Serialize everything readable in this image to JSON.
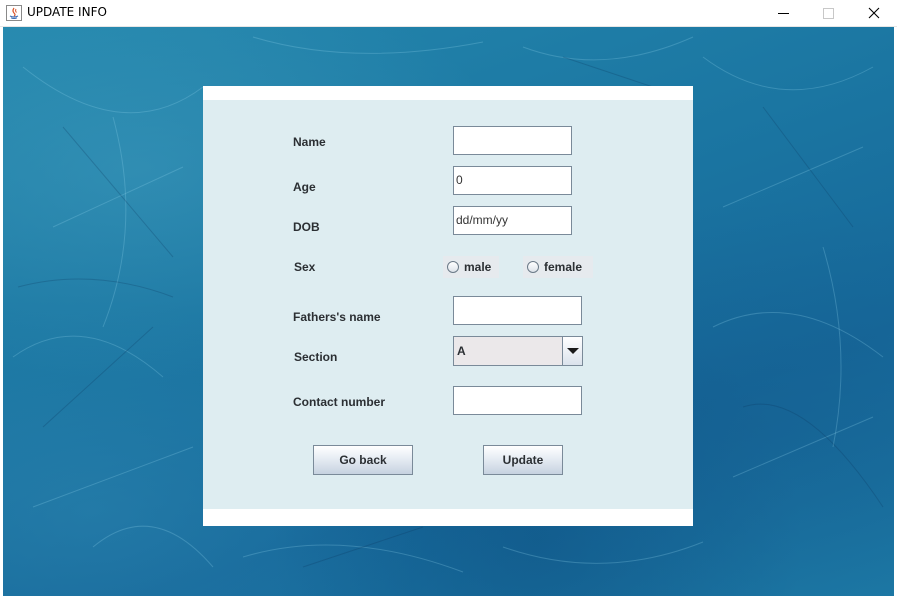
{
  "window": {
    "title": "UPDATE INFO",
    "controls": {
      "minimize": "minimize-icon",
      "maximize": "maximize-icon",
      "close": "close-icon"
    }
  },
  "form": {
    "name_label": "Name",
    "name_value": "",
    "age_label": "Age",
    "age_value": "0",
    "dob_label": "DOB",
    "dob_value": "dd/mm/yy",
    "sex_label": "Sex",
    "sex_options": [
      "male",
      "female"
    ],
    "father_label": "Fathers's name",
    "father_value": "",
    "section_label": "Section",
    "section_value": "A",
    "contact_label": "Contact number",
    "contact_value": ""
  },
  "buttons": {
    "back": "Go back",
    "update": "Update"
  },
  "colors": {
    "background": "#1b76a2",
    "panel": "#deedf1",
    "panel_border": "#ffffff"
  }
}
